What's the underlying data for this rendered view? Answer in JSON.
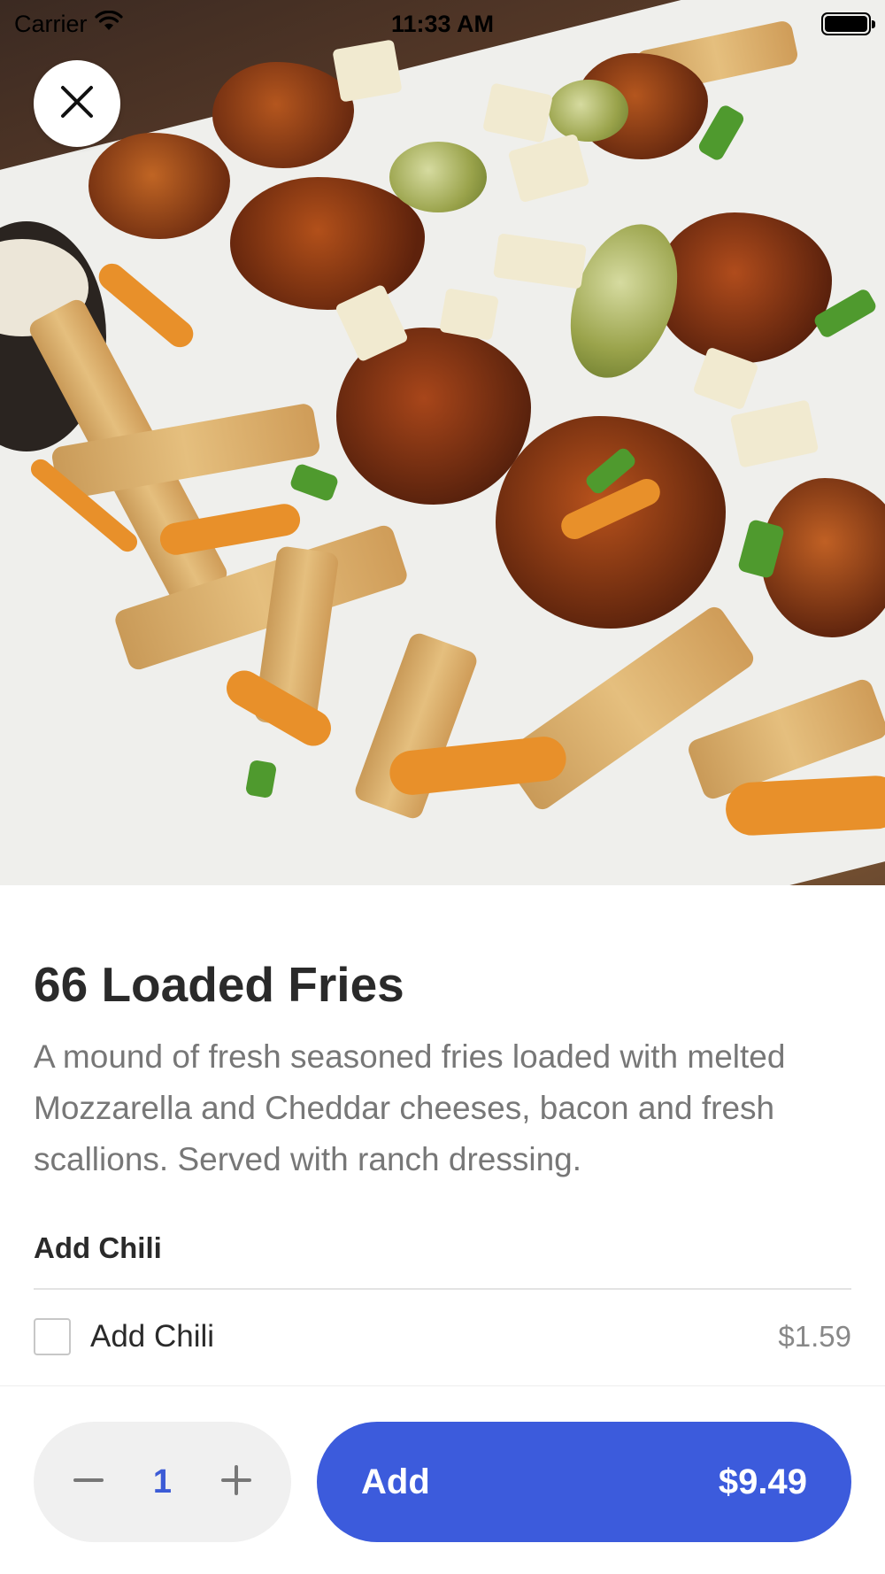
{
  "status_bar": {
    "carrier": "Carrier",
    "time": "11:33 AM"
  },
  "hero": {
    "image_subject": "loaded fries with chicken, pickles and sauce"
  },
  "item": {
    "title": "66 Loaded Fries",
    "description": "A mound of fresh seasoned fries loaded with melted Mozzarella and Cheddar cheeses, bacon and fresh scallions. Served with ranch dressing."
  },
  "options_section": {
    "header": "Add Chili",
    "options": [
      {
        "label": "Add Chili",
        "price": "$1.59",
        "checked": false
      }
    ]
  },
  "order_bar": {
    "quantity": "1",
    "add_label": "Add",
    "total": "$9.49"
  },
  "colors": {
    "accent": "#3c5bdc",
    "quantity_text": "#3c5bd6",
    "title_text": "#2a2a2a",
    "description_text": "#777777"
  },
  "icons": {
    "close": "close-icon",
    "minus": "minus-icon",
    "plus": "plus-icon",
    "wifi": "wifi-icon",
    "battery": "battery-icon"
  }
}
